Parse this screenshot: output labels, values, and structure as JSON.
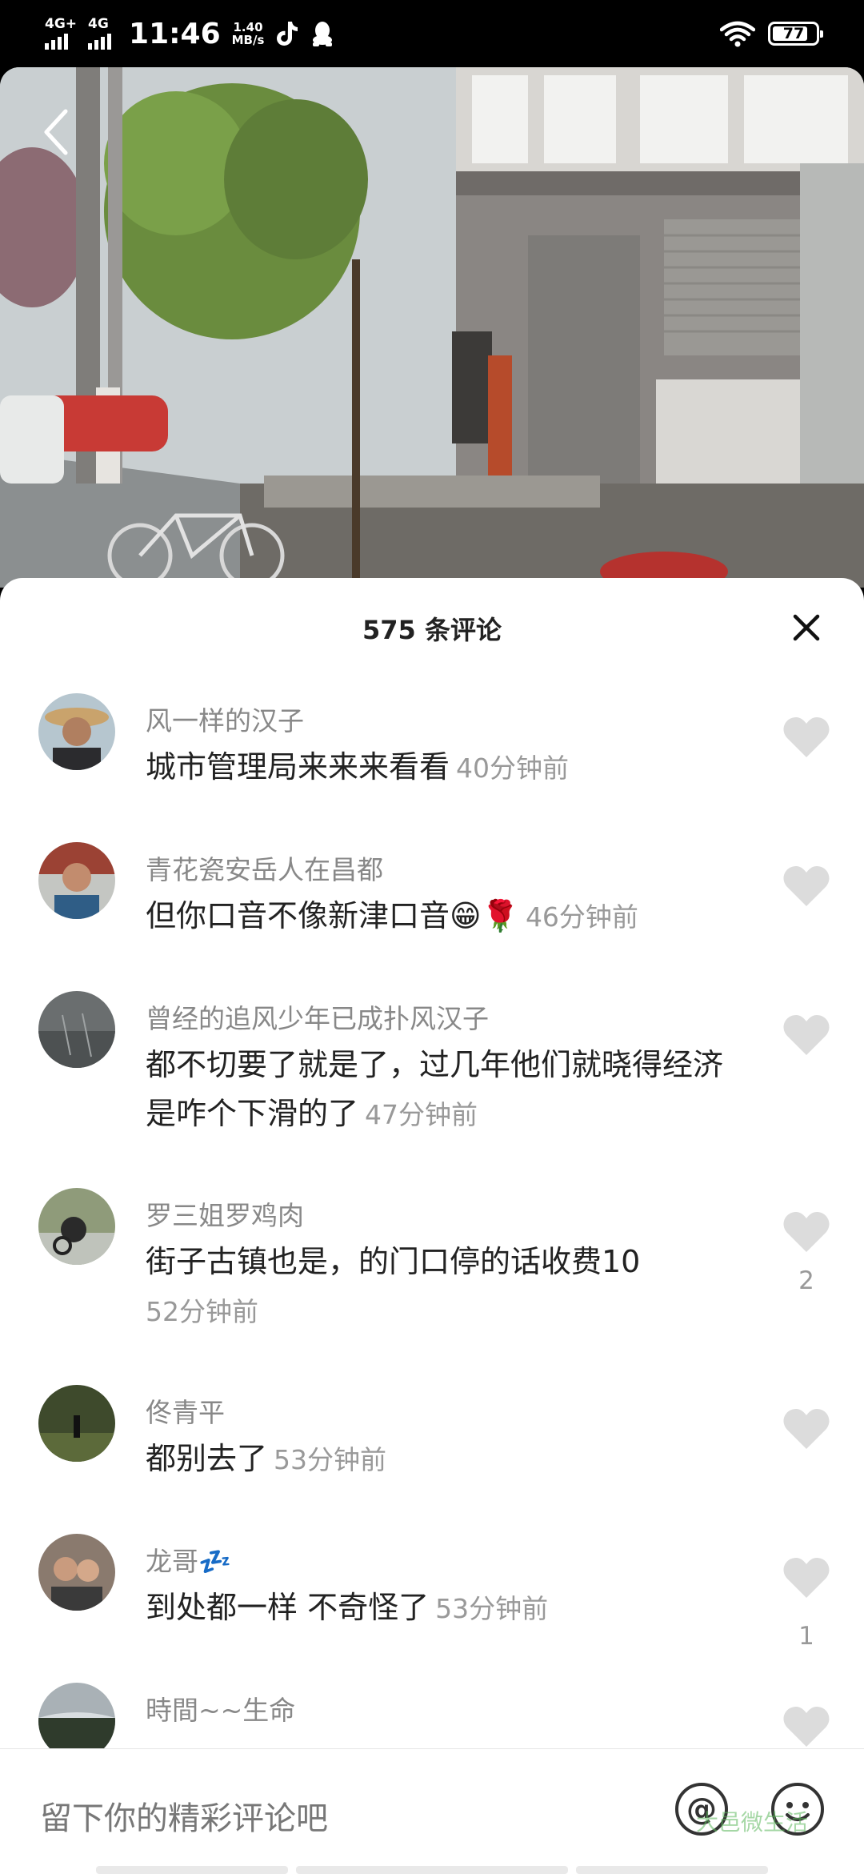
{
  "status_bar": {
    "network1": "4G+",
    "network2": "4G",
    "time": "11:46",
    "speed_value": "1.40",
    "speed_unit": "MB/s",
    "battery": "77"
  },
  "sheet": {
    "title": "575 条评论"
  },
  "comments": [
    {
      "name": "风一样的汉子",
      "text": "城市管理局来来来看看",
      "time": "40分钟前",
      "likes": ""
    },
    {
      "name": "青花瓷安岳人在昌都",
      "text": "但你口音不像新津口音😁🌹",
      "time": "46分钟前",
      "likes": ""
    },
    {
      "name": "曾经的追风少年已成扑风汉子",
      "text": "都不切要了就是了，过几年他们就晓得经济是咋个下滑的了",
      "time": "47分钟前",
      "likes": ""
    },
    {
      "name": "罗三姐罗鸡肉",
      "text": "街子古镇也是，的门口停的话收费10",
      "time": "52分钟前",
      "likes": "2"
    },
    {
      "name": "佟青平",
      "text": "都别去了",
      "time": "53分钟前",
      "likes": ""
    },
    {
      "name": "龙哥💤",
      "text": "到处都一样 不奇怪了",
      "time": "53分钟前",
      "likes": "1"
    },
    {
      "name": "時間~~生命",
      "text": "",
      "time": "",
      "likes": ""
    }
  ],
  "input": {
    "placeholder": "留下你的精彩评论吧",
    "at_symbol": "@",
    "watermark": "大邑微生活"
  }
}
